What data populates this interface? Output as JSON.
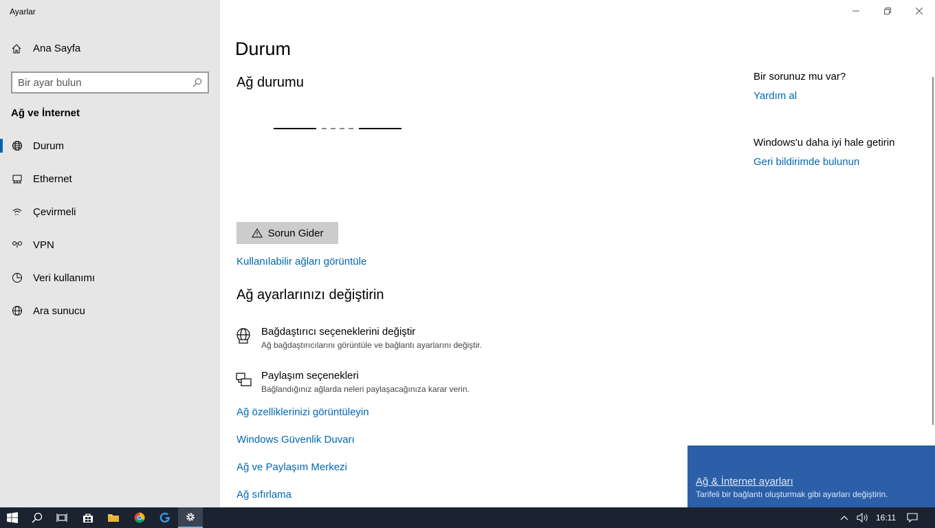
{
  "app": {
    "title": "Ayarlar"
  },
  "sidebar": {
    "home_label": "Ana Sayfa",
    "search_placeholder": "Bir ayar bulun",
    "section_title": "Ağ ve İnternet",
    "items": [
      {
        "label": "Durum",
        "icon": "globe-icon",
        "active": true
      },
      {
        "label": "Ethernet",
        "icon": "ethernet-icon",
        "active": false
      },
      {
        "label": "Çevirmeli",
        "icon": "dialup-icon",
        "active": false
      },
      {
        "label": "VPN",
        "icon": "vpn-icon",
        "active": false
      },
      {
        "label": "Veri kullanımı",
        "icon": "data-usage-icon",
        "active": false
      },
      {
        "label": "Ara sunucu",
        "icon": "proxy-icon",
        "active": false
      }
    ]
  },
  "main": {
    "title": "Durum",
    "network_status_heading": "Ağ durumu",
    "troubleshoot_label": "Sorun Gider",
    "view_networks_link": "Kullanılabilir ağları görüntüle",
    "change_settings_heading": "Ağ ayarlarınızı değiştirin",
    "options": [
      {
        "title": "Bağdaştırıcı seçeneklerini değiştir",
        "subtitle": "Ağ bağdaştırıcılarını görüntüle ve bağlantı ayarlarını değiştir.",
        "icon": "adapter-icon"
      },
      {
        "title": "Paylaşım seçenekleri",
        "subtitle": "Bağlandığınız ağlarda neleri paylaşacağınıza karar verin.",
        "icon": "sharing-icon"
      }
    ],
    "links": [
      "Ağ özelliklerinizi görüntüleyin",
      "Windows Güvenlik Duvarı",
      "Ağ ve Paylaşım Merkezi",
      "Ağ sıfırlama"
    ]
  },
  "right": {
    "question_heading": "Bir sorunuz mu var?",
    "help_link": "Yardım al",
    "improve_heading": "Windows'u daha iyi hale getirin",
    "feedback_link": "Geri bildirimde bulunun"
  },
  "toast": {
    "title": "Ağ & İnternet ayarları",
    "subtitle": "Tarifeli bir bağlantı oluşturmak gibi ayarları değiştirin."
  },
  "taskbar": {
    "time": "16:11",
    "accent": "#76b9ed"
  }
}
